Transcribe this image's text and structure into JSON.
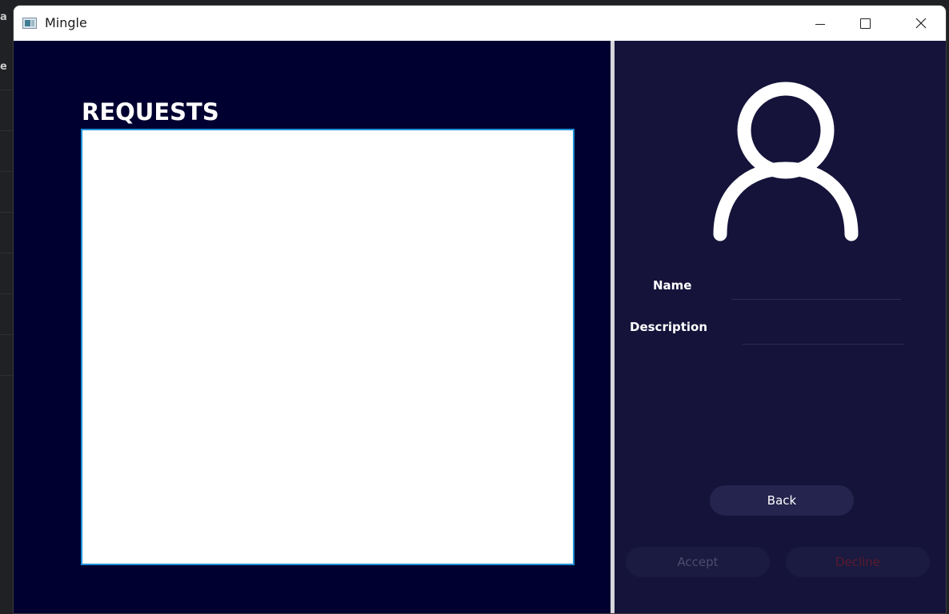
{
  "window": {
    "title": "Mingle",
    "controls": {
      "minimize": "minimize",
      "maximize": "maximize",
      "close": "close"
    }
  },
  "background_fragments": [
    "a",
    "ef"
  ],
  "requests_panel": {
    "heading": "REQUESTS",
    "items": []
  },
  "profile_panel": {
    "avatar_icon": "user-avatar-icon",
    "name_label": "Name",
    "name_value": "",
    "description_label": "Description",
    "description_value": ""
  },
  "actions": {
    "back_label": "Back",
    "accept_label": "Accept",
    "decline_label": "Decline"
  },
  "colors": {
    "left_background": "#000030",
    "right_background": "#15133a",
    "list_border": "#1e8fd6",
    "back_button": "#25244e",
    "decline_text": "#5a1a2c"
  }
}
